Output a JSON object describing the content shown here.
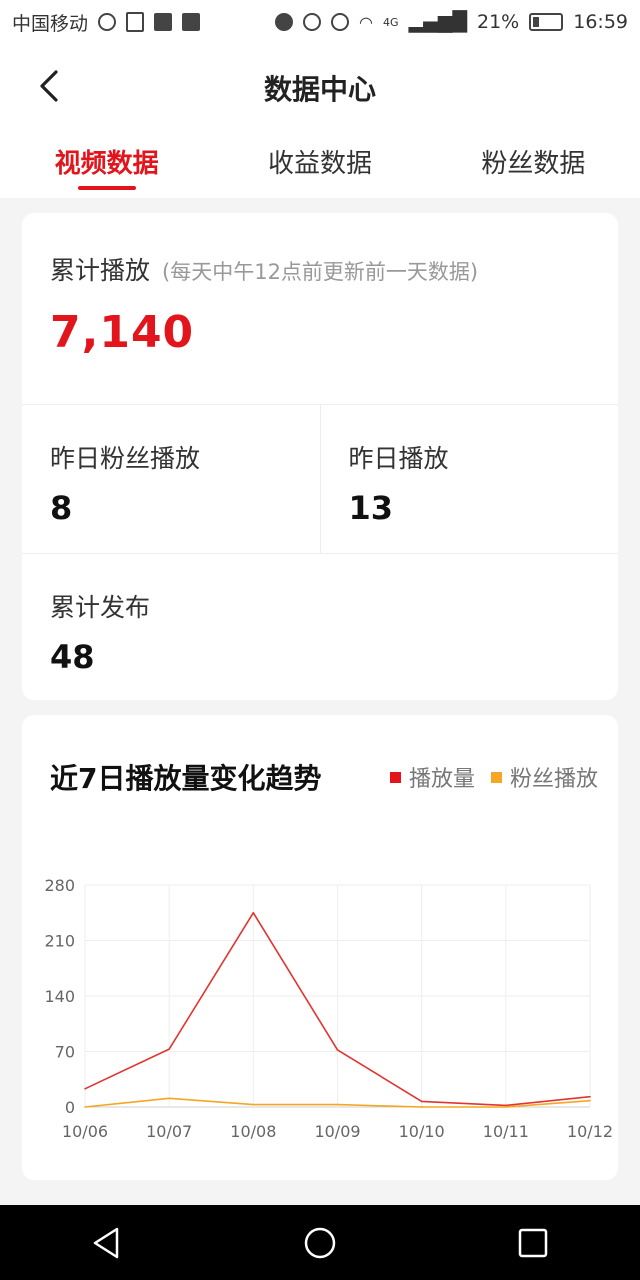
{
  "status_bar": {
    "carrier": "中国移动",
    "signal": "4G",
    "battery": "21%",
    "time": "16:59"
  },
  "header": {
    "title": "数据中心"
  },
  "tabs": [
    {
      "label": "视频数据",
      "active": true
    },
    {
      "label": "收益数据",
      "active": false
    },
    {
      "label": "粉丝数据",
      "active": false
    }
  ],
  "summary": {
    "total_plays_label": "累计播放",
    "total_plays_note": "(每天中午12点前更新前一天数据)",
    "total_plays_value": "7,140",
    "yesterday_fan_plays_label": "昨日粉丝播放",
    "yesterday_fan_plays_value": "8",
    "yesterday_plays_label": "昨日播放",
    "yesterday_plays_value": "13",
    "total_published_label": "累计发布",
    "total_published_value": "48"
  },
  "chart_section": {
    "title": "近7日播放量变化趋势"
  },
  "chart_data": {
    "type": "line",
    "categories": [
      "10/06",
      "10/07",
      "10/08",
      "10/09",
      "10/10",
      "10/11",
      "10/12"
    ],
    "series": [
      {
        "name": "播放量",
        "color": "#e3342f",
        "values": [
          23,
          73,
          245,
          72,
          7,
          2,
          13
        ]
      },
      {
        "name": "粉丝播放",
        "color": "#f5a623",
        "values": [
          0,
          11,
          3,
          3,
          0,
          0,
          8
        ]
      }
    ],
    "yticks": [
      0,
      70,
      140,
      210,
      280
    ],
    "ylim": [
      0,
      280
    ],
    "grid": true
  }
}
